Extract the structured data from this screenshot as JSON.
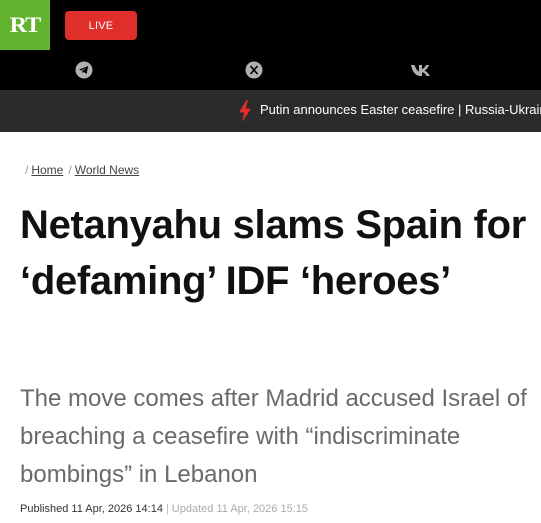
{
  "header": {
    "logo_text": "RT",
    "live_label": "LIVE",
    "social_icons": [
      "telegram-icon",
      "x-icon",
      "vk-icon"
    ]
  },
  "ticker": {
    "text": "Putin announces Easter ceasefire | Russia-Ukraine"
  },
  "breadcrumb": {
    "items": [
      "Home",
      "World News"
    ]
  },
  "article": {
    "headline": "Netanyahu slams Spain for ‘defaming’ IDF ‘heroes’",
    "summary": "The move comes after Madrid accused Israel of breaching a ceasefire with “indiscriminate bombings” in Lebanon",
    "published_label": "Published",
    "published_time": "11 Apr, 2026 14:14",
    "updated_label": "Updated",
    "updated_time": "11 Apr, 2026 15:15"
  },
  "colors": {
    "logo": "#63b32e",
    "live": "#e02e2a",
    "ticker_bg": "#2b2b2b",
    "bolt": "#e02e2a"
  }
}
